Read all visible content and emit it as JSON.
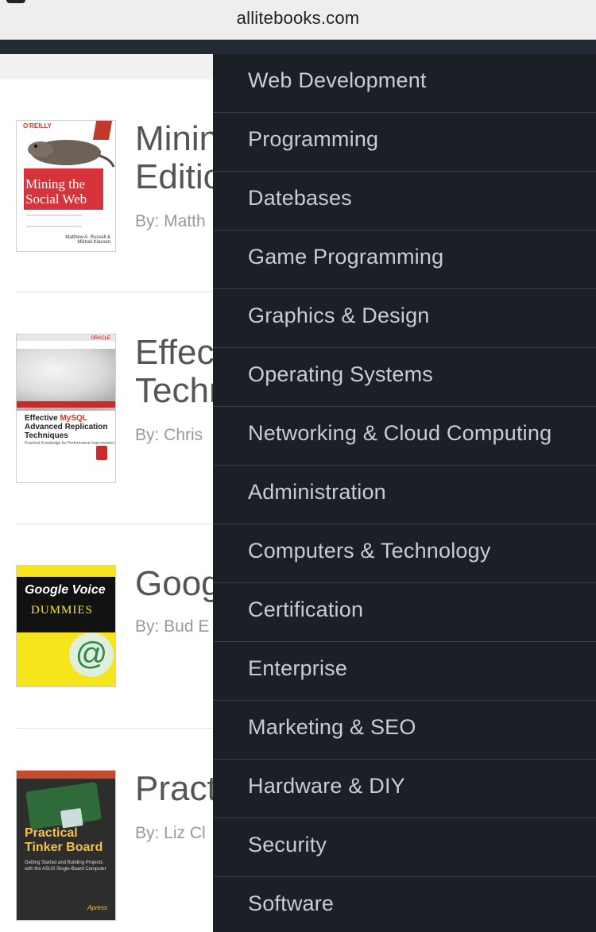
{
  "browser": {
    "url": "allitebooks.com"
  },
  "books": [
    {
      "title": "Minin\nEditio",
      "author": "By: Matth",
      "cover_title": "Mining the\nSocial Web",
      "cover_publisher": "O'REILLY",
      "cover_authors": "Matthew A. Russell &\nMikhail Klassen"
    },
    {
      "title": "Effec\nTechn",
      "author": "By: Chris",
      "cover_title_before": "Effective ",
      "cover_title_highlight": "MySQL",
      "cover_title_after": "\nAdvanced Replication\nTechniques",
      "cover_subtitle": "Practical Knowledge for Performance Improvement",
      "cover_publisher": "ORACLE"
    },
    {
      "title": "Goog",
      "author": "By: Bud E",
      "cover_title": "Google Voice",
      "cover_series": "DUMMIES"
    },
    {
      "title": "Pract",
      "author": "By: Liz Cl",
      "cover_title": "Practical\nTinker Board",
      "cover_subtitle": "Getting Started and Building Projects with the ASUS Single-Board Computer",
      "cover_publisher": "Apress"
    }
  ],
  "category_menu": {
    "items": [
      "Web Development",
      "Programming",
      "Datebases",
      "Game Programming",
      "Graphics & Design",
      "Operating Systems",
      "Networking & Cloud Computing",
      "Administration",
      "Computers & Technology",
      "Certification",
      "Enterprise",
      "Marketing & SEO",
      "Hardware & DIY",
      "Security",
      "Software"
    ]
  },
  "colors": {
    "menu_bg": "#1b1f26",
    "menu_text": "#c9cdd3",
    "menu_divider": "#39404a",
    "header_bg": "#242a34",
    "title_text": "#555555",
    "author_text": "#999999"
  }
}
